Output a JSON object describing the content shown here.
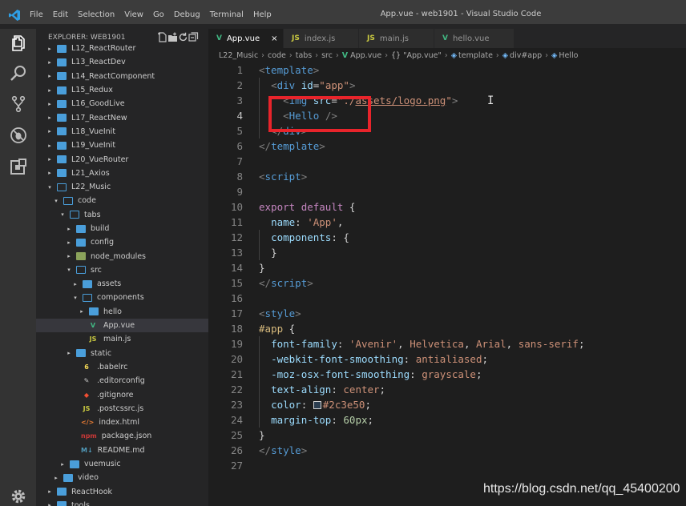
{
  "titlebar": {
    "menu": [
      "File",
      "Edit",
      "Selection",
      "View",
      "Go",
      "Debug",
      "Terminal",
      "Help"
    ],
    "window_title": "App.vue - web1901 - Visual Studio Code"
  },
  "activity_bar": {
    "icons": [
      "explorer-icon",
      "search-icon",
      "source-control-icon",
      "debug-icon",
      "extensions-icon",
      "settings-gear-icon"
    ]
  },
  "explorer": {
    "header": "EXPLORER: WEB1901",
    "items": [
      {
        "label": "L12_ReactRouter",
        "kind": "folder"
      },
      {
        "label": "L13_ReactDev",
        "kind": "folder"
      },
      {
        "label": "L14_ReactComponent",
        "kind": "folder"
      },
      {
        "label": "L15_Redux",
        "kind": "folder"
      },
      {
        "label": "L16_GoodLive",
        "kind": "folder"
      },
      {
        "label": "L17_ReactNew",
        "kind": "folder"
      },
      {
        "label": "L18_VueInit",
        "kind": "folder"
      },
      {
        "label": "L19_VueInit",
        "kind": "folder"
      },
      {
        "label": "L20_VueRouter",
        "kind": "folder"
      },
      {
        "label": "L21_Axios",
        "kind": "folder"
      },
      {
        "label": "L22_Music",
        "kind": "folder-open"
      },
      {
        "label": "code",
        "kind": "folder-open"
      },
      {
        "label": "tabs",
        "kind": "folder-open"
      },
      {
        "label": "build",
        "kind": "folder"
      },
      {
        "label": "config",
        "kind": "folder"
      },
      {
        "label": "node_modules",
        "kind": "folder-nm"
      },
      {
        "label": "src",
        "kind": "folder-open"
      },
      {
        "label": "assets",
        "kind": "folder"
      },
      {
        "label": "components",
        "kind": "folder-open"
      },
      {
        "label": "hello",
        "kind": "folder"
      },
      {
        "label": "App.vue",
        "kind": "vue"
      },
      {
        "label": "main.js",
        "kind": "js"
      },
      {
        "label": "static",
        "kind": "folder"
      },
      {
        "label": ".babelrc",
        "kind": "babel"
      },
      {
        "label": ".editorconfig",
        "kind": "editorconfig"
      },
      {
        "label": ".gitignore",
        "kind": "git"
      },
      {
        "label": ".postcssrc.js",
        "kind": "js"
      },
      {
        "label": "index.html",
        "kind": "html"
      },
      {
        "label": "package.json",
        "kind": "npm"
      },
      {
        "label": "README.md",
        "kind": "md"
      },
      {
        "label": "vuemusic",
        "kind": "folder"
      },
      {
        "label": "video",
        "kind": "folder"
      },
      {
        "label": "ReactHook",
        "kind": "folder"
      },
      {
        "label": "tools",
        "kind": "folder"
      }
    ]
  },
  "tabs": [
    {
      "label": "App.vue",
      "icon": "V",
      "active": true,
      "close": "×"
    },
    {
      "label": "index.js",
      "icon": "JS",
      "active": false
    },
    {
      "label": "main.js",
      "icon": "JS",
      "active": false
    },
    {
      "label": "hello.vue",
      "icon": "V",
      "active": false
    }
  ],
  "breadcrumb": [
    "L22_Music",
    "code",
    "tabs",
    "src",
    "App.vue",
    "\"App.vue\"",
    "template",
    "div#app",
    "Hello"
  ],
  "editor": {
    "current_line": 4,
    "lines": [
      "1",
      "2",
      "3",
      "4",
      "5",
      "6",
      "7",
      "8",
      "9",
      "10",
      "11",
      "12",
      "13",
      "14",
      "15",
      "16",
      "17",
      "18",
      "19",
      "20",
      "21",
      "22",
      "23",
      "24",
      "25",
      "26",
      "27"
    ]
  },
  "watermark": "https://blog.csdn.net/qq_45400200",
  "colors": {
    "highlight_box": "#e8242b",
    "vue_green": "#41b883",
    "js_yellow": "#cbcb41"
  }
}
